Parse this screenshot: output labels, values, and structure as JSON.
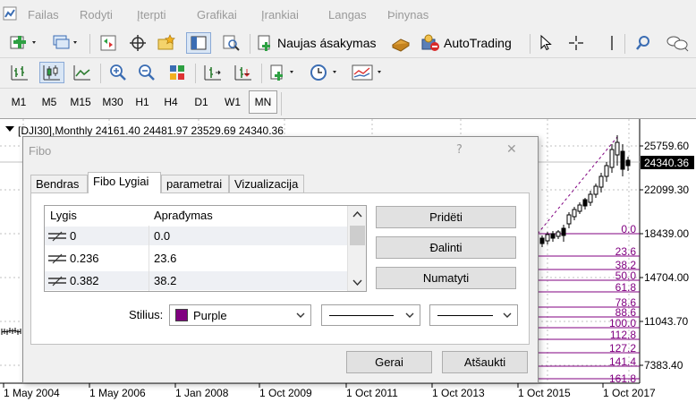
{
  "menu": {
    "items": [
      "Failas",
      "Rodyti",
      "Įterpti",
      "Grafikai",
      "Įrankiai",
      "Langas",
      "Þinynas"
    ]
  },
  "toolbar": {
    "new_order_label": "Naujas ásakymas",
    "autotrading_label": "AutoTrading"
  },
  "timeframes": [
    "M1",
    "M5",
    "M15",
    "M30",
    "H1",
    "H4",
    "D1",
    "W1",
    "MN"
  ],
  "timeframe_active": "MN",
  "chart": {
    "header": "[DJI30],Monthly  24161.40 24481.97 23529.69 24340.36",
    "current_price": "24340.36",
    "price_ticks": [
      "25759.60",
      "22099.30",
      "18439.00",
      "14704.00",
      "11043.70",
      "7383.40"
    ],
    "date_ticks": [
      "1 May 2004",
      "1 May 2006",
      "1 Jan 2008",
      "1 Oct 2009",
      "1 Oct 2011",
      "1 Oct 2013",
      "1 Oct 2015",
      "1 Oct 2017"
    ],
    "fib_levels": [
      "0.0",
      "23.6",
      "38.2",
      "50.0",
      "61.8",
      "78.6",
      "88.6",
      "100.0",
      "112.8",
      "127.2",
      "141.4",
      "161.8"
    ],
    "colors": {
      "fib": "#800080",
      "current_price_bg": "#000000"
    }
  },
  "dialog": {
    "title": "Fibo",
    "help": "?",
    "close": "✕",
    "tabs": [
      "Bendras",
      "Fibo Lygiai",
      "parametrai",
      "Vizualizacija"
    ],
    "active_tab": "Fibo Lygiai",
    "table": {
      "col_level": "Lygis",
      "col_desc": "Aprađymas",
      "rows": [
        {
          "level": "0",
          "desc": "0.0"
        },
        {
          "level": "0.236",
          "desc": "23.6"
        },
        {
          "level": "0.382",
          "desc": "38.2"
        }
      ]
    },
    "buttons": {
      "add": "Pridëti",
      "delete": "Đalinti",
      "defaults": "Numatyti",
      "ok": "Gerai",
      "cancel": "Atšaukti"
    },
    "style_label": "Stilius:",
    "color_value": "Purple",
    "color_swatch": "#800080"
  }
}
